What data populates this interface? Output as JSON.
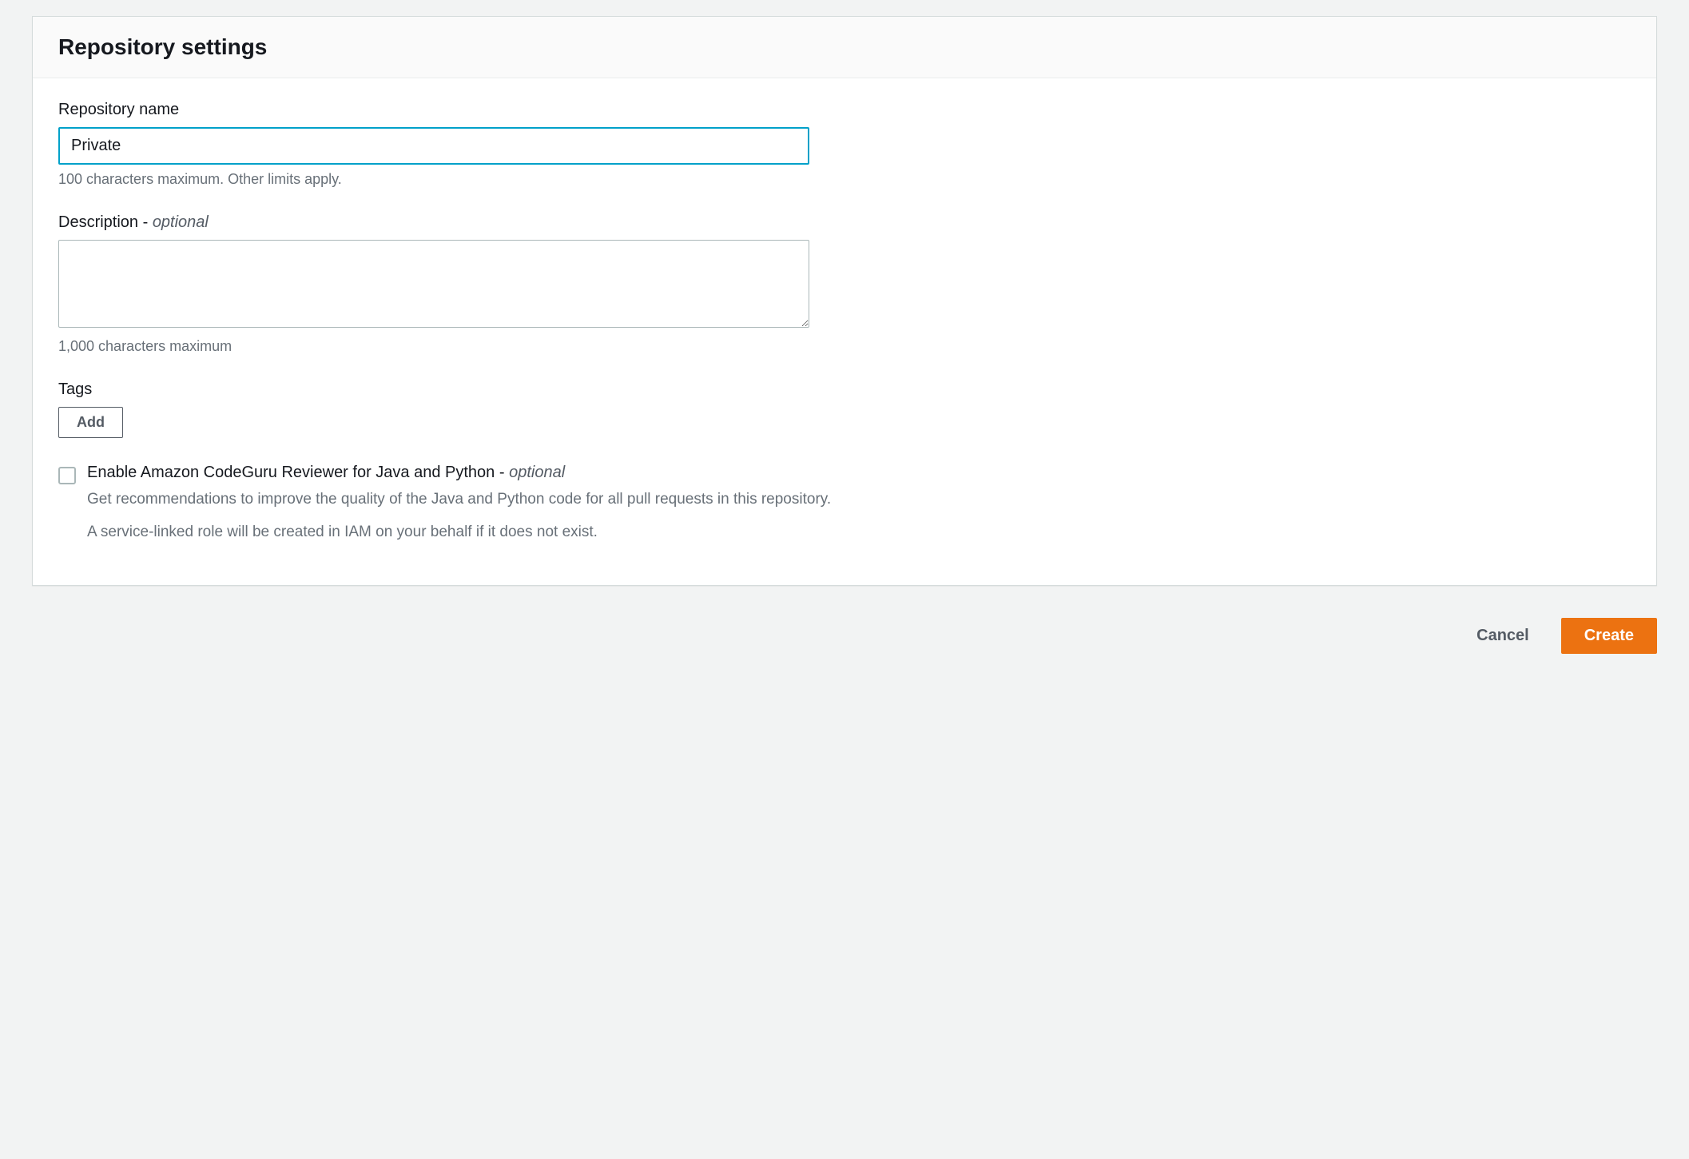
{
  "panel": {
    "title": "Repository settings"
  },
  "repo_name": {
    "label": "Repository name",
    "value": "Private",
    "hint": "100 characters maximum. Other limits apply."
  },
  "description": {
    "label": "Description - ",
    "optional": "optional",
    "value": "",
    "hint": "1,000 characters maximum"
  },
  "tags": {
    "label": "Tags",
    "add_label": "Add"
  },
  "codeguru": {
    "label": "Enable Amazon CodeGuru Reviewer for Java and Python - ",
    "optional": "optional",
    "desc1": "Get recommendations to improve the quality of the Java and Python code for all pull requests in this repository.",
    "desc2": "A service-linked role will be created in IAM on your behalf if it does not exist."
  },
  "footer": {
    "cancel": "Cancel",
    "create": "Create"
  }
}
